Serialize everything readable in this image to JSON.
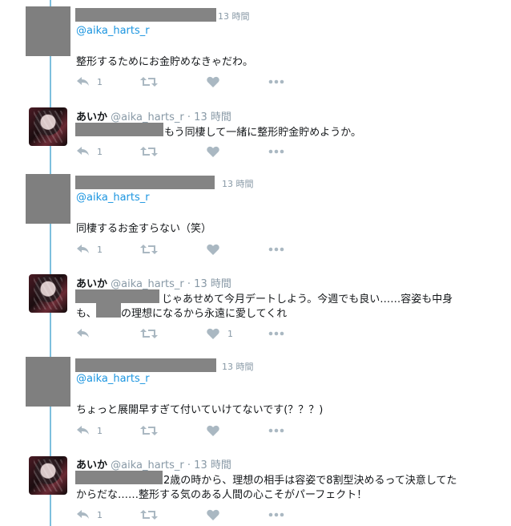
{
  "time_label": "13 時間",
  "mention": "@aika_harts_r",
  "reply_count": "1",
  "like_count": "1",
  "aika": {
    "name": "あいか",
    "handle": "@aika_harts_r"
  },
  "tweets": [
    {
      "text": "整形するためにお金貯めなきゃだわ。"
    },
    {
      "text": "もう同棲して一緒に整形貯金貯めようか。"
    },
    {
      "text": "同棲するお金すらない（笑）"
    },
    {
      "line1": "じゃあせめて今月デートしよう。今週でも良い……容姿も中身",
      "line2_prefix": "も、",
      "line2_suffix": "の理想になるから永遠に愛してくれ"
    },
    {
      "text": "ちょっと展開早すぎて付いていけてないです(？？？)"
    },
    {
      "line1": "2歳の時から、理想の相手は容姿で8割型決めるって決意してた",
      "line2": "からだな……整形する気のある人間の心こそがパーフェクト！"
    }
  ]
}
